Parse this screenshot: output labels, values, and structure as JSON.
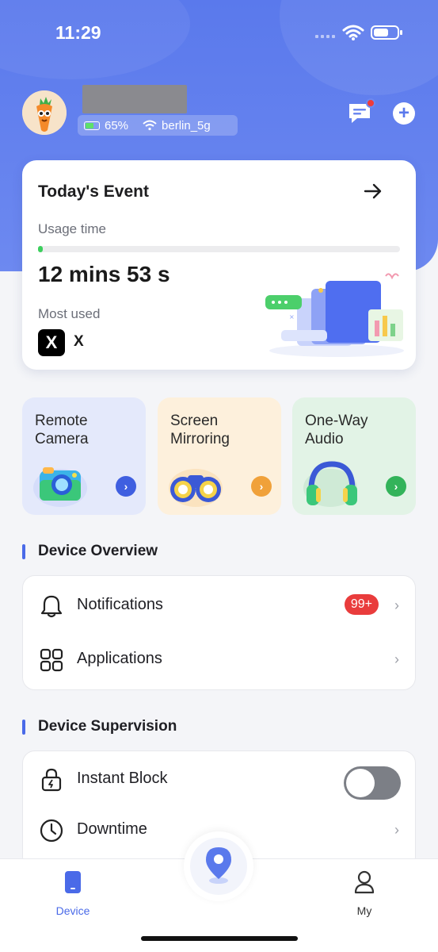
{
  "status_bar": {
    "time": "11:29"
  },
  "header": {
    "device_battery": "65%",
    "device_wifi": "berlin_5g",
    "has_unread_messages": true
  },
  "event_card": {
    "title": "Today's Event",
    "usage_label": "Usage time",
    "usage_progress": 0.01,
    "usage_value": "12 mins 53 s",
    "most_used_label": "Most used",
    "most_used_app_icon": "X",
    "most_used_app": "X"
  },
  "features": [
    {
      "label": "Remote Camera",
      "icon": "camera-icon",
      "accent": "#3f5fe0"
    },
    {
      "label": "Screen Mirroring",
      "icon": "binoculars-icon",
      "accent": "#f0a13a"
    },
    {
      "label": "One-Way Audio",
      "icon": "headphones-icon",
      "accent": "#33b35a"
    }
  ],
  "device_overview": {
    "title": "Device Overview",
    "items": [
      {
        "label": "Notifications",
        "badge": "99+",
        "icon": "bell-icon"
      },
      {
        "label": "Applications",
        "icon": "apps-grid-icon"
      }
    ]
  },
  "device_supervision": {
    "title": "Device Supervision",
    "items": [
      {
        "label": "Instant Block",
        "icon": "lock-icon",
        "toggle": false
      },
      {
        "label": "Downtime",
        "icon": "clock-icon"
      }
    ]
  },
  "tabbar": {
    "items": [
      {
        "label": "Device",
        "active": true
      },
      {
        "label": "My",
        "active": false
      }
    ]
  }
}
